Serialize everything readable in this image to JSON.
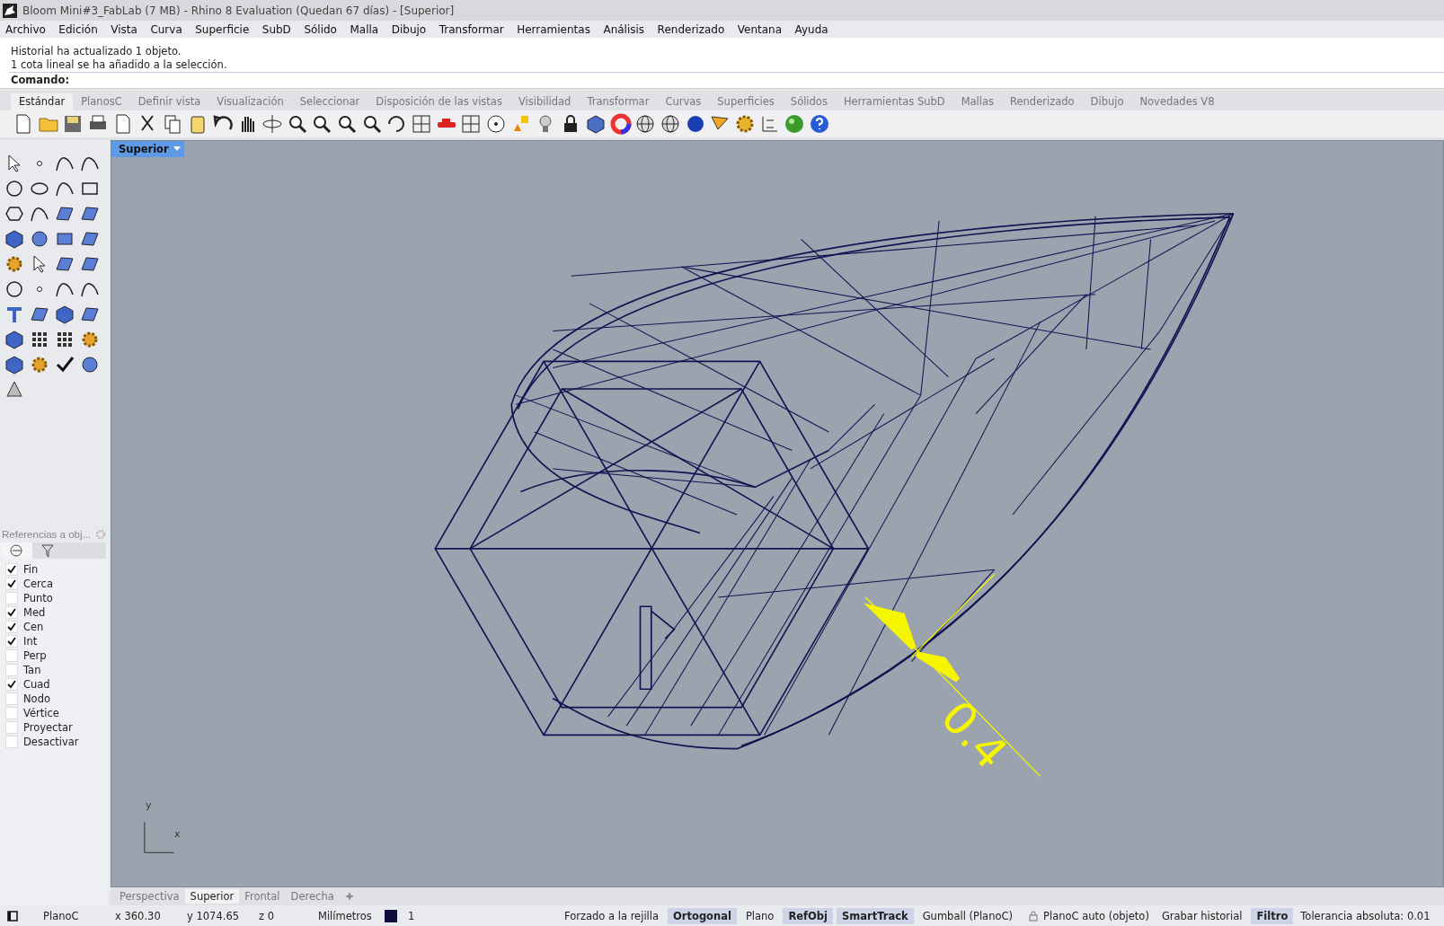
{
  "window": {
    "title": "Bloom Mini#3_FabLab (7 MB) - Rhino 8 Evaluation (Quedan 67 días) - [Superior]"
  },
  "menu": [
    "Archivo",
    "Edición",
    "Vista",
    "Curva",
    "Superficie",
    "SubD",
    "Sólido",
    "Malla",
    "Dibujo",
    "Transformar",
    "Herramientas",
    "Análisis",
    "Renderizado",
    "Ventana",
    "Ayuda"
  ],
  "command_history": [
    "Historial ha actualizado 1 objeto.",
    "1 cota lineal se ha añadido a la selección."
  ],
  "command_prompt": "Comando:",
  "toolbar_tabs": [
    {
      "label": "Estándar",
      "selected": true
    },
    {
      "label": "PlanosC",
      "selected": false
    },
    {
      "label": "Definir vista",
      "selected": false
    },
    {
      "label": "Visualización",
      "selected": false
    },
    {
      "label": "Seleccionar",
      "selected": false
    },
    {
      "label": "Disposición de las vistas",
      "selected": false
    },
    {
      "label": "Visibilidad",
      "selected": false
    },
    {
      "label": "Transformar",
      "selected": false
    },
    {
      "label": "Curvas",
      "selected": false
    },
    {
      "label": "Superficies",
      "selected": false
    },
    {
      "label": "Sólidos",
      "selected": false
    },
    {
      "label": "Herramientas SubD",
      "selected": false
    },
    {
      "label": "Mallas",
      "selected": false
    },
    {
      "label": "Renderizado",
      "selected": false
    },
    {
      "label": "Dibujo",
      "selected": false
    },
    {
      "label": "Novedades V8",
      "selected": false
    }
  ],
  "osnap_panel": {
    "title": "Referencias a obj...",
    "items": [
      {
        "label": "Fin",
        "checked": true
      },
      {
        "label": "Cerca",
        "checked": true
      },
      {
        "label": "Punto",
        "checked": false
      },
      {
        "label": "Med",
        "checked": true
      },
      {
        "label": "Cen",
        "checked": true
      },
      {
        "label": "Int",
        "checked": true
      },
      {
        "label": "Perp",
        "checked": false
      },
      {
        "label": "Tan",
        "checked": false
      },
      {
        "label": "Cuad",
        "checked": true
      },
      {
        "label": "Nodo",
        "checked": false
      },
      {
        "label": "Vértice",
        "checked": false
      },
      {
        "label": "Proyectar",
        "checked": false
      },
      {
        "label": "Desactivar",
        "checked": false
      }
    ]
  },
  "viewport": {
    "title": "Superior",
    "dimension_text": "0.4",
    "axis_x": "x",
    "axis_y": "y"
  },
  "viewport_tabs": [
    {
      "label": "Perspectiva",
      "selected": false
    },
    {
      "label": "Superior",
      "selected": true
    },
    {
      "label": "Frontal",
      "selected": false
    },
    {
      "label": "Derecha",
      "selected": false
    }
  ],
  "status_bar": {
    "cplane": "PlanoC",
    "x": "x 360.30",
    "y": "y 1074.65",
    "z": "z 0",
    "units": "Milímetros",
    "layer": {
      "name": "1",
      "color": "#0d0d3d"
    },
    "toggles": [
      {
        "label": "Forzado a la rejilla",
        "on": false
      },
      {
        "label": "Ortogonal",
        "on": true
      },
      {
        "label": "Plano",
        "on": false
      },
      {
        "label": "RefObj",
        "on": true
      },
      {
        "label": "SmartTrack",
        "on": true
      },
      {
        "label": "Gumball (PlanoC)",
        "on": false
      }
    ],
    "lock_label": "PlanoC auto (objeto)",
    "toggles_2": [
      {
        "label": "Grabar historial",
        "on": false
      },
      {
        "label": "Filtro",
        "on": true
      }
    ],
    "tolerance": "Tolerancia absoluta: 0.01"
  }
}
